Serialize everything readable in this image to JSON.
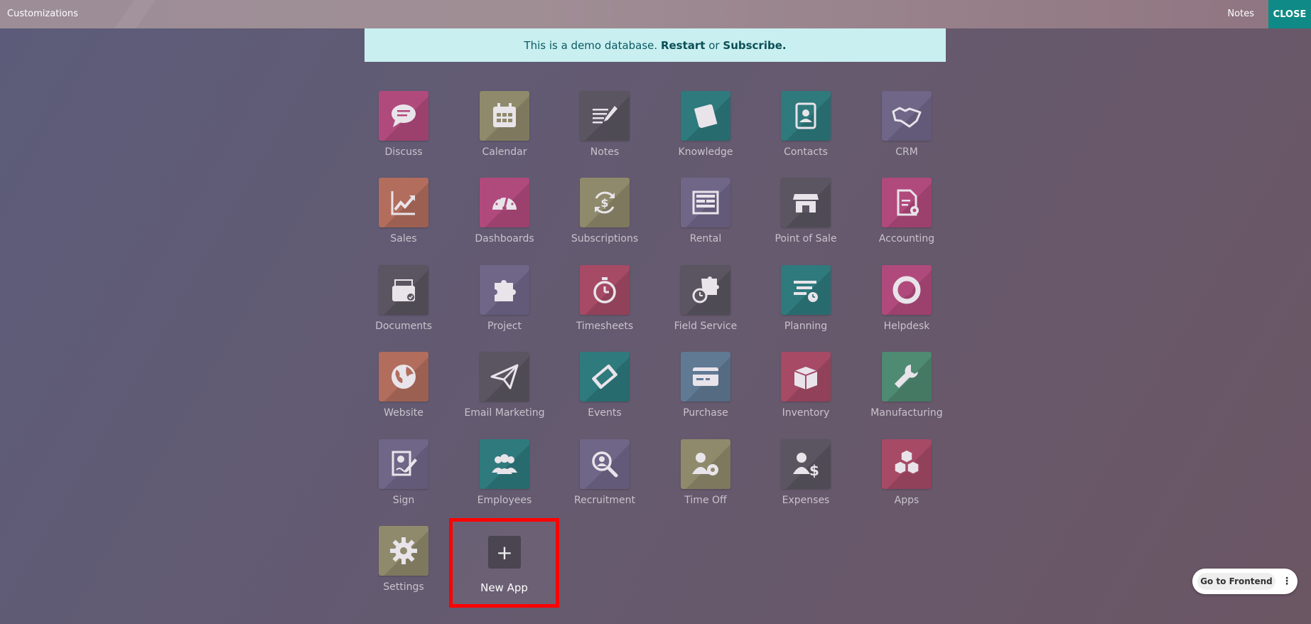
{
  "topbar": {
    "title": "Customizations",
    "notes_label": "Notes",
    "close_label": "CLOSE"
  },
  "banner": {
    "text": "This is a demo database.",
    "restart": "Restart",
    "or": "or",
    "subscribe": "Subscribe."
  },
  "apps": [
    {
      "label": "Discuss",
      "icon": "chat-bubble-icon",
      "color": "#b14a7c"
    },
    {
      "label": "Calendar",
      "icon": "calendar-icon",
      "color": "#8f8a6b"
    },
    {
      "label": "Notes",
      "icon": "notes-icon",
      "color": "#5a5560"
    },
    {
      "label": "Knowledge",
      "icon": "book-icon",
      "color": "#2e7a7d"
    },
    {
      "label": "Contacts",
      "icon": "address-book-icon",
      "color": "#2e7a7d"
    },
    {
      "label": "CRM",
      "icon": "handshake-icon",
      "color": "#6f6688"
    },
    {
      "label": "Sales",
      "icon": "chart-trend-icon",
      "color": "#b26d5d"
    },
    {
      "label": "Dashboards",
      "icon": "gauge-icon",
      "color": "#b14a7c"
    },
    {
      "label": "Subscriptions",
      "icon": "recurring-dollar-icon",
      "color": "#8f8a6b"
    },
    {
      "label": "Rental",
      "icon": "rental-grid-icon",
      "color": "#6f6688"
    },
    {
      "label": "Point of Sale",
      "icon": "shop-icon",
      "color": "#5a5560"
    },
    {
      "label": "Accounting",
      "icon": "invoice-gear-icon",
      "color": "#b14a7c"
    },
    {
      "label": "Documents",
      "icon": "document-tray-icon",
      "color": "#5a5560"
    },
    {
      "label": "Project",
      "icon": "puzzle-icon",
      "color": "#6f6688"
    },
    {
      "label": "Timesheets",
      "icon": "stopwatch-icon",
      "color": "#a64a66"
    },
    {
      "label": "Field Service",
      "icon": "puzzle-clock-icon",
      "color": "#5a5560"
    },
    {
      "label": "Planning",
      "icon": "planning-lines-icon",
      "color": "#2e7a7d"
    },
    {
      "label": "Helpdesk",
      "icon": "lifebuoy-icon",
      "color": "#b14a7c"
    },
    {
      "label": "Website",
      "icon": "globe-icon",
      "color": "#b26d5d"
    },
    {
      "label": "Email Marketing",
      "icon": "paper-plane-icon",
      "color": "#5a5560"
    },
    {
      "label": "Events",
      "icon": "ticket-icon",
      "color": "#2e7a7d"
    },
    {
      "label": "Purchase",
      "icon": "credit-card-icon",
      "color": "#607a94"
    },
    {
      "label": "Inventory",
      "icon": "box-icon",
      "color": "#a64a66"
    },
    {
      "label": "Manufacturing",
      "icon": "wrench-icon",
      "color": "#4f8a72"
    },
    {
      "label": "Sign",
      "icon": "sign-document-icon",
      "color": "#6f6688"
    },
    {
      "label": "Employees",
      "icon": "people-icon",
      "color": "#2e7a7d"
    },
    {
      "label": "Recruitment",
      "icon": "magnifier-person-icon",
      "color": "#6f6688"
    },
    {
      "label": "Time Off",
      "icon": "person-gear-icon",
      "color": "#8f8a6b"
    },
    {
      "label": "Expenses",
      "icon": "person-dollar-icon",
      "color": "#5a5560"
    },
    {
      "label": "Apps",
      "icon": "cubes-icon",
      "color": "#a64a66"
    },
    {
      "label": "Settings",
      "icon": "gear-icon",
      "color": "#8f8a6b"
    }
  ],
  "new_app": {
    "label": "New App",
    "icon": "plus-icon"
  },
  "frontend": {
    "label": "Go to Frontend",
    "more": "⋮"
  }
}
